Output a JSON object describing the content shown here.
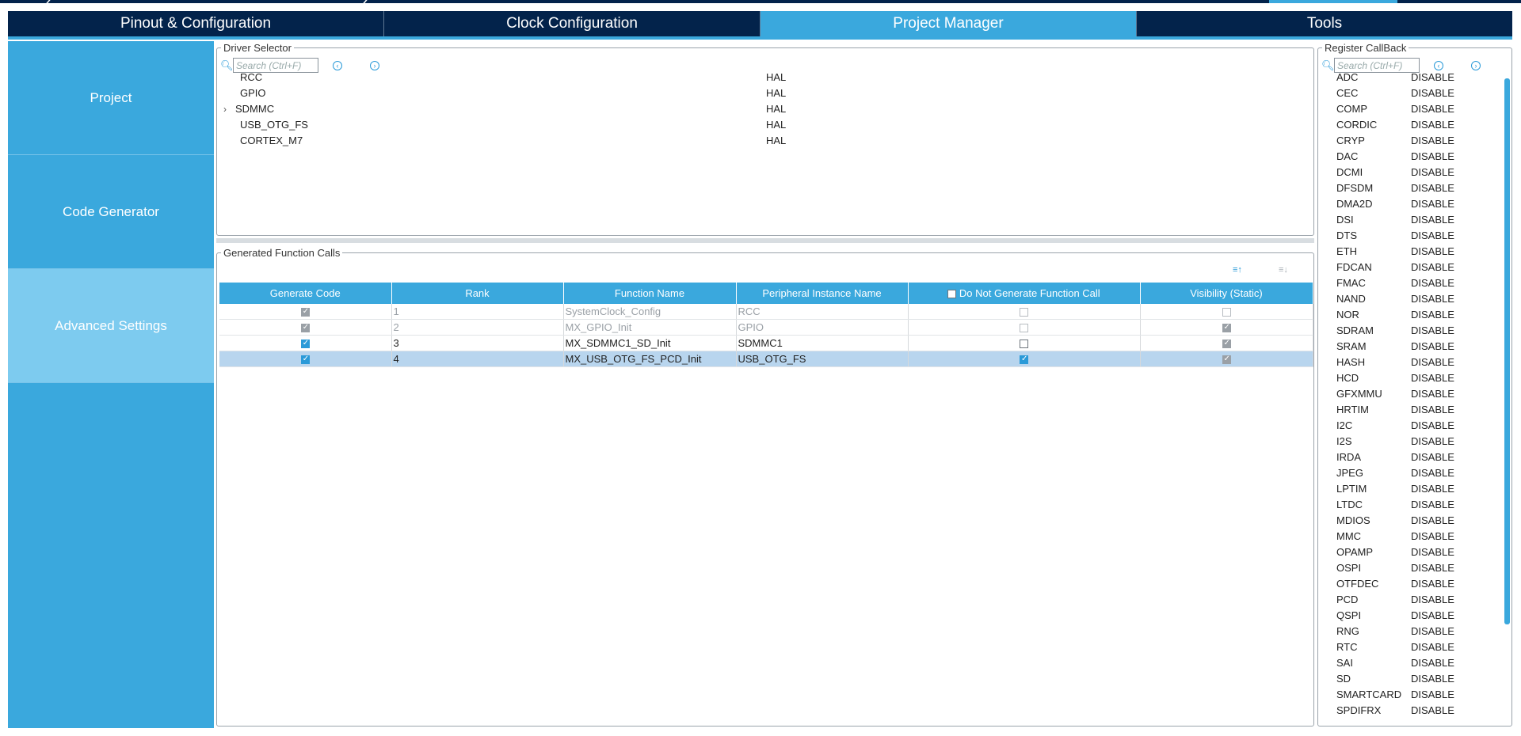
{
  "tabs": [
    {
      "label": "Pinout & Configuration",
      "active": false
    },
    {
      "label": "Clock Configuration",
      "active": false
    },
    {
      "label": "Project Manager",
      "active": true
    },
    {
      "label": "Tools",
      "active": false
    }
  ],
  "sidebar": {
    "items": [
      {
        "label": "Project",
        "active": false
      },
      {
        "label": "Code Generator",
        "active": false
      },
      {
        "label": "Advanced Settings",
        "active": true
      }
    ]
  },
  "driver_selector": {
    "title": "Driver Selector",
    "search_placeholder": "Search (Ctrl+F)",
    "rows": [
      {
        "name": "RCC",
        "value": "HAL",
        "expandable": false
      },
      {
        "name": "GPIO",
        "value": "HAL",
        "expandable": false
      },
      {
        "name": "SDMMC",
        "value": "HAL",
        "expandable": true
      },
      {
        "name": "USB_OTG_FS",
        "value": "HAL",
        "expandable": false
      },
      {
        "name": "CORTEX_M7",
        "value": "HAL",
        "expandable": false
      }
    ]
  },
  "function_calls": {
    "title": "Generated Function Calls",
    "columns": [
      "Generate Code",
      "Rank",
      "Function Name",
      "Peripheral Instance Name",
      "Do Not Generate Function Call",
      "Visibility (Static)"
    ],
    "rows": [
      {
        "generate": true,
        "rank": "1",
        "function": "SystemClock_Config",
        "instance": "RCC",
        "do_not_generate": false,
        "visibility": false,
        "dim": true,
        "selected": false
      },
      {
        "generate": true,
        "rank": "2",
        "function": "MX_GPIO_Init",
        "instance": "GPIO",
        "do_not_generate": false,
        "visibility": true,
        "dim": true,
        "selected": false
      },
      {
        "generate": true,
        "rank": "3",
        "function": "MX_SDMMC1_SD_Init",
        "instance": "SDMMC1",
        "do_not_generate": false,
        "visibility": true,
        "dim": false,
        "selected": false
      },
      {
        "generate": true,
        "rank": "4",
        "function": "MX_USB_OTG_FS_PCD_Init",
        "instance": "USB_OTG_FS",
        "do_not_generate": true,
        "visibility": true,
        "dim": false,
        "selected": true
      }
    ]
  },
  "register_callback": {
    "title": "Register CallBack",
    "search_placeholder": "Search (Ctrl+F)",
    "rows": [
      {
        "name": "ADC",
        "value": "DISABLE"
      },
      {
        "name": "CEC",
        "value": "DISABLE"
      },
      {
        "name": "COMP",
        "value": "DISABLE"
      },
      {
        "name": "CORDIC",
        "value": "DISABLE"
      },
      {
        "name": "CRYP",
        "value": "DISABLE"
      },
      {
        "name": "DAC",
        "value": "DISABLE"
      },
      {
        "name": "DCMI",
        "value": "DISABLE"
      },
      {
        "name": "DFSDM",
        "value": "DISABLE"
      },
      {
        "name": "DMA2D",
        "value": "DISABLE"
      },
      {
        "name": "DSI",
        "value": "DISABLE"
      },
      {
        "name": "DTS",
        "value": "DISABLE"
      },
      {
        "name": "ETH",
        "value": "DISABLE"
      },
      {
        "name": "FDCAN",
        "value": "DISABLE"
      },
      {
        "name": "FMAC",
        "value": "DISABLE"
      },
      {
        "name": "NAND",
        "value": "DISABLE"
      },
      {
        "name": "NOR",
        "value": "DISABLE"
      },
      {
        "name": "SDRAM",
        "value": "DISABLE"
      },
      {
        "name": "SRAM",
        "value": "DISABLE"
      },
      {
        "name": "HASH",
        "value": "DISABLE"
      },
      {
        "name": "HCD",
        "value": "DISABLE"
      },
      {
        "name": "GFXMMU",
        "value": "DISABLE"
      },
      {
        "name": "HRTIM",
        "value": "DISABLE"
      },
      {
        "name": "I2C",
        "value": "DISABLE"
      },
      {
        "name": "I2S",
        "value": "DISABLE"
      },
      {
        "name": "IRDA",
        "value": "DISABLE"
      },
      {
        "name": "JPEG",
        "value": "DISABLE"
      },
      {
        "name": "LPTIM",
        "value": "DISABLE"
      },
      {
        "name": "LTDC",
        "value": "DISABLE"
      },
      {
        "name": "MDIOS",
        "value": "DISABLE"
      },
      {
        "name": "MMC",
        "value": "DISABLE"
      },
      {
        "name": "OPAMP",
        "value": "DISABLE"
      },
      {
        "name": "OSPI",
        "value": "DISABLE"
      },
      {
        "name": "OTFDEC",
        "value": "DISABLE"
      },
      {
        "name": "PCD",
        "value": "DISABLE"
      },
      {
        "name": "QSPI",
        "value": "DISABLE"
      },
      {
        "name": "RNG",
        "value": "DISABLE"
      },
      {
        "name": "RTC",
        "value": "DISABLE"
      },
      {
        "name": "SAI",
        "value": "DISABLE"
      },
      {
        "name": "SD",
        "value": "DISABLE"
      },
      {
        "name": "SMARTCARD",
        "value": "DISABLE"
      },
      {
        "name": "SPDIFRX",
        "value": "DISABLE"
      }
    ]
  },
  "colors": {
    "navy": "#03234b",
    "accent": "#3aa8dd",
    "sidebar_active": "#7dcbef",
    "row_selected": "#b8d5ee"
  }
}
